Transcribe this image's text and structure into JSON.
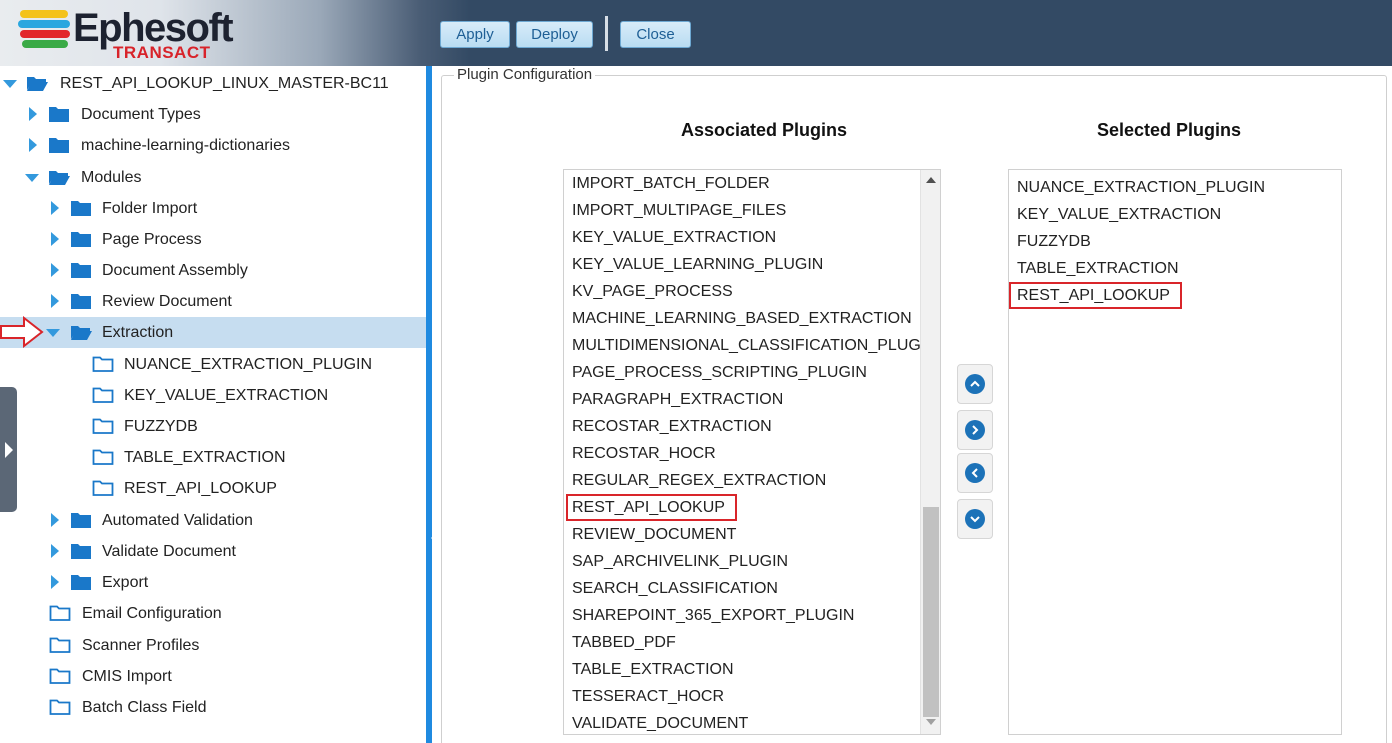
{
  "header": {
    "logo_text": "Ephesoft",
    "logo_subtext": "TRANSACT",
    "buttons": {
      "apply": "Apply",
      "deploy": "Deploy",
      "close": "Close"
    }
  },
  "tree": {
    "root": "REST_API_LOOKUP_LINUX_MASTER-BC11",
    "document_types": "Document Types",
    "ml_dictionaries": "machine-learning-dictionaries",
    "modules": "Modules",
    "folder_import": "Folder Import",
    "page_process": "Page Process",
    "document_assembly": "Document Assembly",
    "review_document": "Review Document",
    "extraction": "Extraction",
    "extraction_plugins": [
      "NUANCE_EXTRACTION_PLUGIN",
      "KEY_VALUE_EXTRACTION",
      "FUZZYDB",
      "TABLE_EXTRACTION",
      "REST_API_LOOKUP"
    ],
    "automated_validation": "Automated Validation",
    "validate_document": "Validate Document",
    "export": "Export",
    "email_configuration": "Email Configuration",
    "scanner_profiles": "Scanner Profiles",
    "cmis_import": "CMIS Import",
    "batch_class_field": "Batch Class Field"
  },
  "main": {
    "legend": "Plugin Configuration",
    "associated_title": "Associated Plugins",
    "selected_title": "Selected Plugins",
    "associated": [
      "IMPORT_BATCH_FOLDER",
      "IMPORT_MULTIPAGE_FILES",
      "KEY_VALUE_EXTRACTION",
      "KEY_VALUE_LEARNING_PLUGIN",
      "KV_PAGE_PROCESS",
      "MACHINE_LEARNING_BASED_EXTRACTION",
      "MULTIDIMENSIONAL_CLASSIFICATION_PLUG",
      "PAGE_PROCESS_SCRIPTING_PLUGIN",
      "PARAGRAPH_EXTRACTION",
      "RECOSTAR_EXTRACTION",
      "RECOSTAR_HOCR",
      "REGULAR_REGEX_EXTRACTION",
      "REST_API_LOOKUP",
      "REVIEW_DOCUMENT",
      "SAP_ARCHIVELINK_PLUGIN",
      "SEARCH_CLASSIFICATION",
      "SHAREPOINT_365_EXPORT_PLUGIN",
      "TABBED_PDF",
      "TABLE_EXTRACTION",
      "TESSERACT_HOCR",
      "VALIDATE_DOCUMENT"
    ],
    "selected": [
      "NUANCE_EXTRACTION_PLUGIN",
      "KEY_VALUE_EXTRACTION",
      "FUZZYDB",
      "TABLE_EXTRACTION",
      "REST_API_LOOKUP"
    ]
  },
  "colors": {
    "accent": "#1f8ae0",
    "highlight": "#d9252a",
    "header_bg": "#334a64",
    "selected_row": "#c6ddf0"
  }
}
